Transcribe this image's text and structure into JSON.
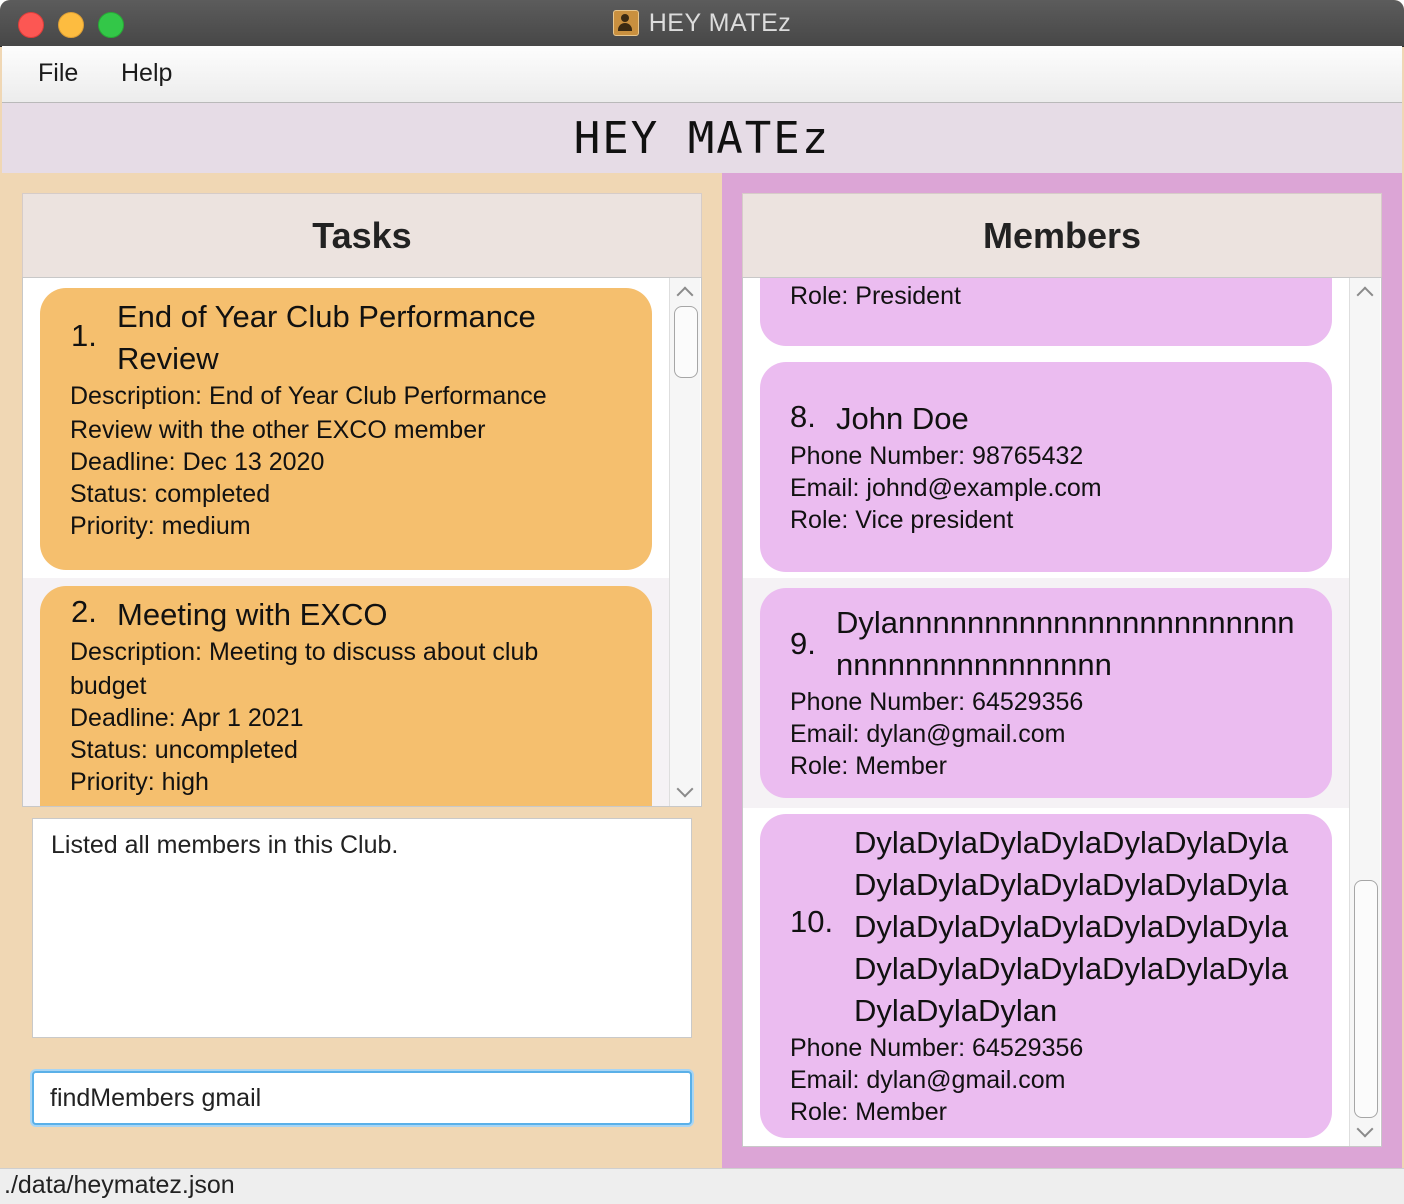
{
  "window": {
    "title": "HEY MATEz"
  },
  "menu": {
    "file": "File",
    "help": "Help"
  },
  "header": {
    "title": "HEY MATEz"
  },
  "tasks": {
    "title": "Tasks",
    "items": [
      {
        "index": "1.",
        "name_lines": [
          "End of Year Club Performance",
          "Review"
        ],
        "lines": [
          "Description: End of Year Club Performance",
          "Review with the other EXCO member",
          "Deadline: Dec 13 2020",
          "Status: completed",
          "Priority: medium"
        ]
      },
      {
        "index": "2.",
        "name_lines": [
          "Meeting with EXCO"
        ],
        "lines": [
          "Description: Meeting to discuss about club",
          "budget",
          "Deadline: Apr 1 2021",
          "Status: uncompleted",
          "Priority: high"
        ]
      }
    ]
  },
  "result": {
    "message": "Listed all members in this Club."
  },
  "command": {
    "value": "findMembers gmail"
  },
  "members": {
    "title": "Members",
    "partial_item": {
      "lines": [
        "Role: President"
      ]
    },
    "items": [
      {
        "index": "8.",
        "name_lines": [
          "John Doe"
        ],
        "lines": [
          "Phone Number: 98765432",
          "Email: johnd@example.com",
          "Role: Vice president"
        ]
      },
      {
        "index": "9.",
        "name_lines": [
          "Dylannnnnnnnnnnnnnnnnnnnnnn",
          "nnnnnnnnnnnnnnnn"
        ],
        "lines": [
          "Phone Number: 64529356",
          "Email: dylan@gmail.com",
          "Role: Member"
        ]
      },
      {
        "index": "10.",
        "name_lines": [
          "DylaDylaDylaDylaDylaDylaDyla",
          "DylaDylaDylaDylaDylaDylaDyla",
          "DylaDylaDylaDylaDylaDylaDyla",
          "DylaDylaDylaDylaDylaDylaDyla",
          "DylaDylaDylan"
        ],
        "lines": [
          "Phone Number: 64529356",
          "Email: dylan@gmail.com",
          "Role: Member"
        ]
      }
    ]
  },
  "status": {
    "path": "./data/heymatez.json"
  },
  "colors": {
    "left_pane_bg": "#f0d7b4",
    "right_pane_bg": "#dca5d6",
    "task_card": "#f5bf6e",
    "member_card": "#ebbcf0",
    "command_focus": "#5ab0e8"
  }
}
